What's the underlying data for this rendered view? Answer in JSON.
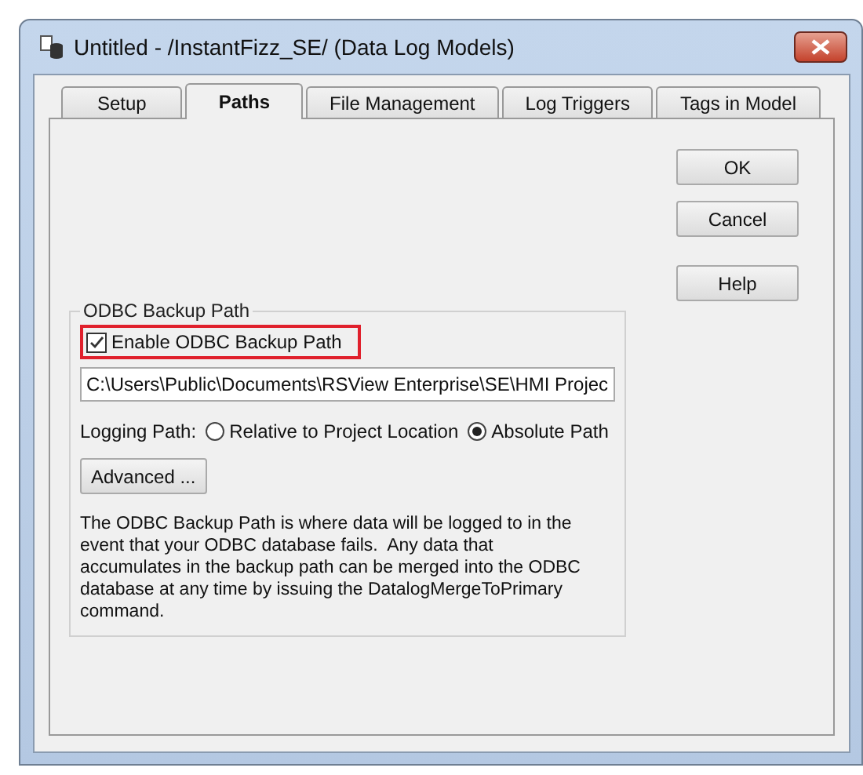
{
  "window": {
    "title": "Untitled - /InstantFizz_SE/ (Data Log Models)"
  },
  "tabs": [
    {
      "label": "Setup",
      "selected": false
    },
    {
      "label": "Paths",
      "selected": true
    },
    {
      "label": "File Management",
      "selected": false
    },
    {
      "label": "Log Triggers",
      "selected": false
    },
    {
      "label": "Tags in Model",
      "selected": false
    }
  ],
  "buttons": [
    "OK",
    "Cancel",
    "Help"
  ],
  "odbc_group": {
    "title": "ODBC Backup Path",
    "enable_checkbox": {
      "label": "Enable ODBC Backup Path",
      "checked": true
    },
    "path_field": {
      "value": "C:\\Users\\Public\\Documents\\RSView Enterprise\\SE\\HMI Projec"
    },
    "logging_path": {
      "label": "Logging Path:",
      "options": [
        {
          "label": "Relative to Project Location",
          "selected": false
        },
        {
          "label": "Absolute Path",
          "selected": true
        }
      ]
    },
    "advanced_button": "Advanced ...",
    "description": "The ODBC Backup Path is where data will be logged to in the event that your ODBC database fails.  Any data that accumulates in the backup path can be merged into the ODBC database at any time by issuing the DatalogMergeToPrimary command."
  }
}
